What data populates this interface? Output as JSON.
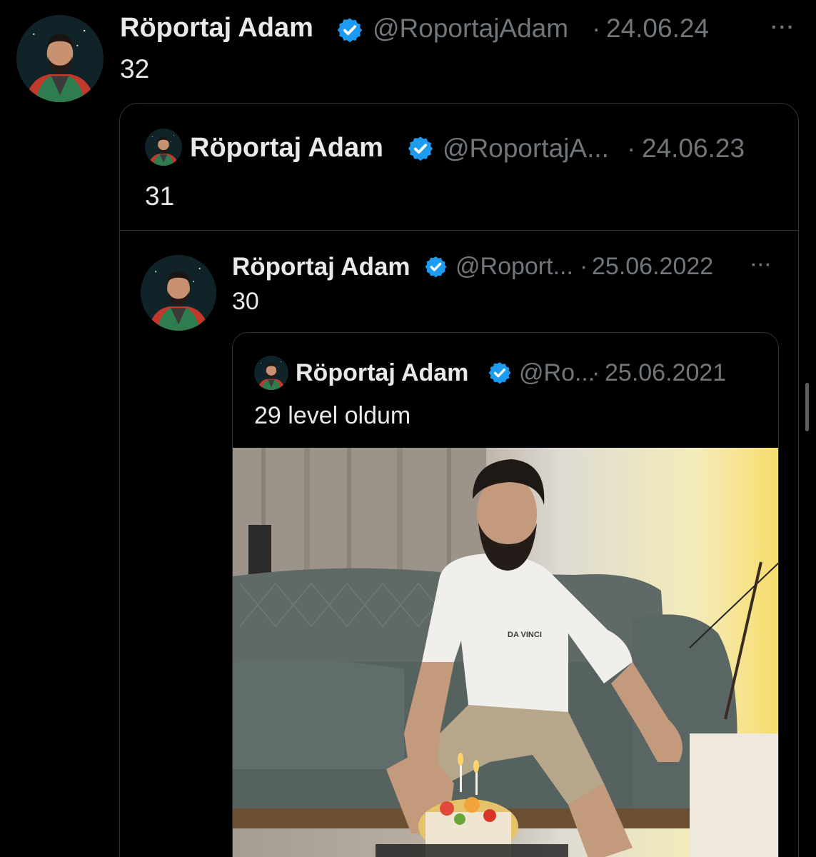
{
  "tweet": {
    "display_name": "Röportaj Adam",
    "handle": "@RoportajAdam",
    "separator": "·",
    "date": "24.06.24",
    "text": "32",
    "more": "···"
  },
  "quote1": {
    "display_name": "Röportaj Adam",
    "handle": "@RoportajA...",
    "separator": "·",
    "date": "24.06.23",
    "text": "31"
  },
  "quote2": {
    "display_name": "Röportaj Adam",
    "handle": "@Roport...",
    "separator": "·",
    "date": "25.06.2022",
    "text": "30",
    "more": "···"
  },
  "quote3": {
    "display_name": "Röportaj Adam",
    "handle": "@Ro...",
    "separator": "·",
    "date": "25.06.2021",
    "text": "29 level oldum",
    "photo_shirt_text": "DA VINCI"
  },
  "icons": {
    "verified": "verified-badge-icon",
    "more": "more-options-icon"
  },
  "colors": {
    "background": "#000000",
    "primary_text": "#e7e9ea",
    "secondary_text": "#71767b",
    "verified_blue": "#1d9bf0",
    "border": "#2f3336"
  }
}
